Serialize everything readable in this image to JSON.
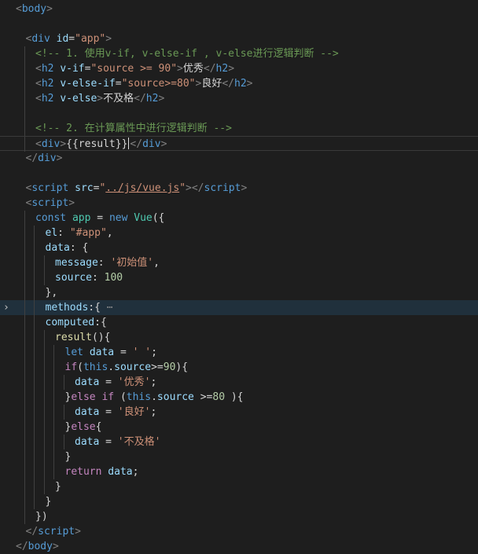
{
  "editor": {
    "lines": [
      {
        "indent": 0,
        "tokens": [
          [
            "br",
            "<"
          ],
          [
            "tag",
            "body"
          ],
          [
            "br",
            ">"
          ]
        ]
      },
      {
        "indent": 1,
        "tokens": []
      },
      {
        "indent": 1,
        "tokens": [
          [
            "br",
            "<"
          ],
          [
            "tag",
            "div "
          ],
          [
            "attr",
            "id"
          ],
          [
            "txt",
            "="
          ],
          [
            "str",
            "\"app\""
          ],
          [
            "br",
            ">"
          ]
        ]
      },
      {
        "indent": 2,
        "tokens": [
          [
            "cmt",
            "<!-- 1. 使用v-if, v-else-if , v-else进行逻辑判断 -->"
          ]
        ]
      },
      {
        "indent": 2,
        "tokens": [
          [
            "br",
            "<"
          ],
          [
            "tag",
            "h2 "
          ],
          [
            "attr",
            "v-if"
          ],
          [
            "txt",
            "="
          ],
          [
            "str",
            "\"source >= 90\""
          ],
          [
            "br",
            ">"
          ],
          [
            "txt",
            "优秀"
          ],
          [
            "br",
            "</"
          ],
          [
            "tag",
            "h2"
          ],
          [
            "br",
            ">"
          ]
        ]
      },
      {
        "indent": 2,
        "tokens": [
          [
            "br",
            "<"
          ],
          [
            "tag",
            "h2 "
          ],
          [
            "attr",
            "v-else-if"
          ],
          [
            "txt",
            "="
          ],
          [
            "str",
            "\"source>=80\""
          ],
          [
            "br",
            ">"
          ],
          [
            "txt",
            "良好"
          ],
          [
            "br",
            "</"
          ],
          [
            "tag",
            "h2"
          ],
          [
            "br",
            ">"
          ]
        ]
      },
      {
        "indent": 2,
        "tokens": [
          [
            "br",
            "<"
          ],
          [
            "tag",
            "h2 "
          ],
          [
            "attr",
            "v-else"
          ],
          [
            "br",
            ">"
          ],
          [
            "txt",
            "不及格"
          ],
          [
            "br",
            "</"
          ],
          [
            "tag",
            "h2"
          ],
          [
            "br",
            ">"
          ]
        ]
      },
      {
        "indent": 2,
        "tokens": []
      },
      {
        "indent": 2,
        "tokens": [
          [
            "cmt",
            "<!-- 2. 在计算属性中进行逻辑判断 -->"
          ]
        ]
      },
      {
        "indent": 2,
        "tokens": [
          [
            "br",
            "<"
          ],
          [
            "tag",
            "div"
          ],
          [
            "br",
            ">"
          ],
          [
            "txt",
            "{{result}}"
          ],
          [
            "caret",
            ""
          ],
          [
            "br",
            "</"
          ],
          [
            "tag",
            "div"
          ],
          [
            "br",
            ">"
          ]
        ],
        "current": true
      },
      {
        "indent": 1,
        "tokens": [
          [
            "br",
            "</"
          ],
          [
            "tag",
            "div"
          ],
          [
            "br",
            ">"
          ]
        ]
      },
      {
        "indent": 1,
        "tokens": []
      },
      {
        "indent": 1,
        "tokens": [
          [
            "br",
            "<"
          ],
          [
            "tag",
            "script "
          ],
          [
            "attr",
            "src"
          ],
          [
            "txt",
            "="
          ],
          [
            "str",
            "\""
          ],
          [
            "link",
            "../js/vue.js"
          ],
          [
            "str",
            "\""
          ],
          [
            "br",
            "></"
          ],
          [
            "tag",
            "script"
          ],
          [
            "br",
            ">"
          ]
        ]
      },
      {
        "indent": 1,
        "tokens": [
          [
            "br",
            "<"
          ],
          [
            "tag",
            "script"
          ],
          [
            "br",
            ">"
          ]
        ]
      },
      {
        "indent": 2,
        "tokens": [
          [
            "kw",
            "const "
          ],
          [
            "cls",
            "app"
          ],
          [
            "txt",
            " = "
          ],
          [
            "kw",
            "new "
          ],
          [
            "cls",
            "Vue"
          ],
          [
            "txt",
            "({"
          ]
        ]
      },
      {
        "indent": 3,
        "tokens": [
          [
            "var",
            "el"
          ],
          [
            "txt",
            ": "
          ],
          [
            "str",
            "\"#app\""
          ],
          [
            "txt",
            ","
          ]
        ]
      },
      {
        "indent": 3,
        "tokens": [
          [
            "var",
            "data"
          ],
          [
            "txt",
            ": {"
          ]
        ]
      },
      {
        "indent": 4,
        "tokens": [
          [
            "var",
            "message"
          ],
          [
            "txt",
            ": "
          ],
          [
            "str",
            "'初始值'"
          ],
          [
            "txt",
            ","
          ]
        ]
      },
      {
        "indent": 4,
        "tokens": [
          [
            "var",
            "source"
          ],
          [
            "txt",
            ": "
          ],
          [
            "num",
            "100"
          ]
        ]
      },
      {
        "indent": 3,
        "tokens": [
          [
            "txt",
            "},"
          ]
        ]
      },
      {
        "indent": 3,
        "tokens": [
          [
            "var",
            "methods"
          ],
          [
            "txt",
            ":{ "
          ],
          [
            "ell",
            "⋯"
          ]
        ],
        "folded": true
      },
      {
        "indent": 3,
        "tokens": [
          [
            "var",
            "computed"
          ],
          [
            "txt",
            ":{"
          ]
        ]
      },
      {
        "indent": 4,
        "tokens": [
          [
            "fn",
            "result"
          ],
          [
            "txt",
            "(){"
          ]
        ]
      },
      {
        "indent": 5,
        "tokens": [
          [
            "kw",
            "let "
          ],
          [
            "var",
            "data"
          ],
          [
            "txt",
            " = "
          ],
          [
            "str",
            "' '"
          ],
          [
            "txt",
            ";"
          ]
        ]
      },
      {
        "indent": 5,
        "tokens": [
          [
            "ctl",
            "if"
          ],
          [
            "txt",
            "("
          ],
          [
            "kw",
            "this"
          ],
          [
            "txt",
            "."
          ],
          [
            "var",
            "source"
          ],
          [
            "txt",
            ">="
          ],
          [
            "num",
            "90"
          ],
          [
            "txt",
            "){"
          ]
        ]
      },
      {
        "indent": 6,
        "tokens": [
          [
            "var",
            "data"
          ],
          [
            "txt",
            " = "
          ],
          [
            "str",
            "'优秀'"
          ],
          [
            "txt",
            ";"
          ]
        ]
      },
      {
        "indent": 5,
        "tokens": [
          [
            "txt",
            "}"
          ],
          [
            "ctl",
            "else if "
          ],
          [
            "txt",
            "("
          ],
          [
            "kw",
            "this"
          ],
          [
            "txt",
            "."
          ],
          [
            "var",
            "source"
          ],
          [
            "txt",
            " >="
          ],
          [
            "num",
            "80"
          ],
          [
            "txt",
            " ){"
          ]
        ]
      },
      {
        "indent": 6,
        "tokens": [
          [
            "var",
            "data"
          ],
          [
            "txt",
            " = "
          ],
          [
            "str",
            "'良好'"
          ],
          [
            "txt",
            ";"
          ]
        ]
      },
      {
        "indent": 5,
        "tokens": [
          [
            "txt",
            "}"
          ],
          [
            "ctl",
            "else"
          ],
          [
            "txt",
            "{"
          ]
        ]
      },
      {
        "indent": 6,
        "tokens": [
          [
            "var",
            "data"
          ],
          [
            "txt",
            " = "
          ],
          [
            "str",
            "'不及格'"
          ]
        ]
      },
      {
        "indent": 5,
        "tokens": [
          [
            "txt",
            "}"
          ]
        ]
      },
      {
        "indent": 5,
        "tokens": [
          [
            "ctl",
            "return "
          ],
          [
            "var",
            "data"
          ],
          [
            "txt",
            ";"
          ]
        ]
      },
      {
        "indent": 4,
        "tokens": [
          [
            "txt",
            "}"
          ]
        ]
      },
      {
        "indent": 3,
        "tokens": [
          [
            "txt",
            "}"
          ]
        ]
      },
      {
        "indent": 2,
        "tokens": [
          [
            "txt",
            "})"
          ]
        ]
      },
      {
        "indent": 1,
        "tokens": [
          [
            "br",
            "</"
          ],
          [
            "tag",
            "script"
          ],
          [
            "br",
            ">"
          ]
        ]
      },
      {
        "indent": 0,
        "tokens": [
          [
            "br",
            "</"
          ],
          [
            "tag",
            "body"
          ],
          [
            "br",
            ">"
          ]
        ]
      }
    ]
  }
}
